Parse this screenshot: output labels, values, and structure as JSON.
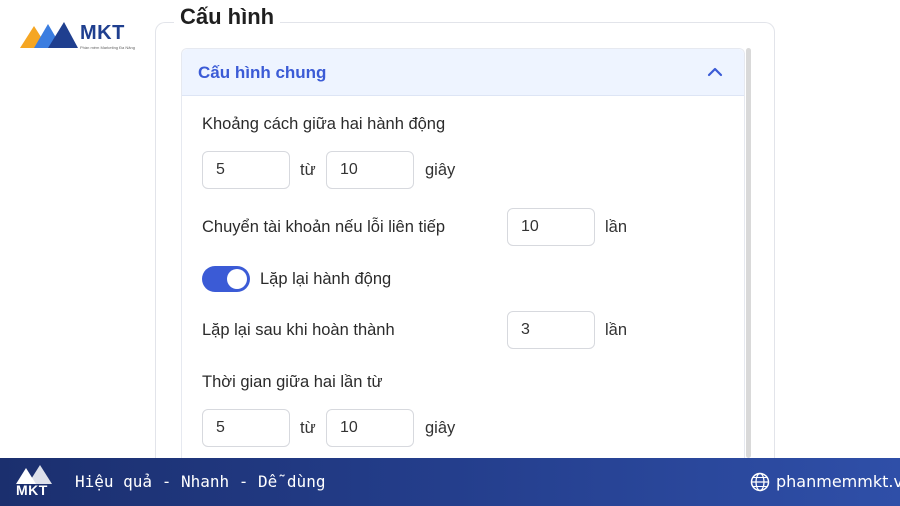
{
  "brand": {
    "logo_text": "MKT",
    "logo_sub": "Phần mềm Marketing Đa Năng",
    "colors": {
      "primary": "#3b5bd6",
      "dark_blue": "#1f3f8f",
      "orange": "#f5a623"
    }
  },
  "section": {
    "legend": "Cấu hình",
    "panel_title": "Cấu hình chung",
    "panel_state_icon": "chevron-up-icon"
  },
  "form": {
    "action_gap": {
      "label": "Khoảng cách giữa hai hành động",
      "from_value": "5",
      "to_word": "từ",
      "to_value": "10",
      "unit": "giây"
    },
    "switch_account": {
      "label": "Chuyển tài khoản nếu lỗi liên tiếp",
      "value": "10",
      "unit": "lần"
    },
    "repeat_toggle": {
      "label": "Lặp lại hành động",
      "enabled": true
    },
    "repeat_after": {
      "label": "Lặp lại sau khi hoàn thành",
      "value": "3",
      "unit": "lần"
    },
    "repeat_gap": {
      "label": "Thời gian giữa hai lần từ",
      "from_value": "5",
      "to_word": "từ",
      "to_value": "10",
      "unit": "giây"
    }
  },
  "footer": {
    "logo_text": "MKT",
    "slogan": "Hiệu quả - Nhanh  - Dễ dùng",
    "website": "phanmemmkt.vn"
  }
}
